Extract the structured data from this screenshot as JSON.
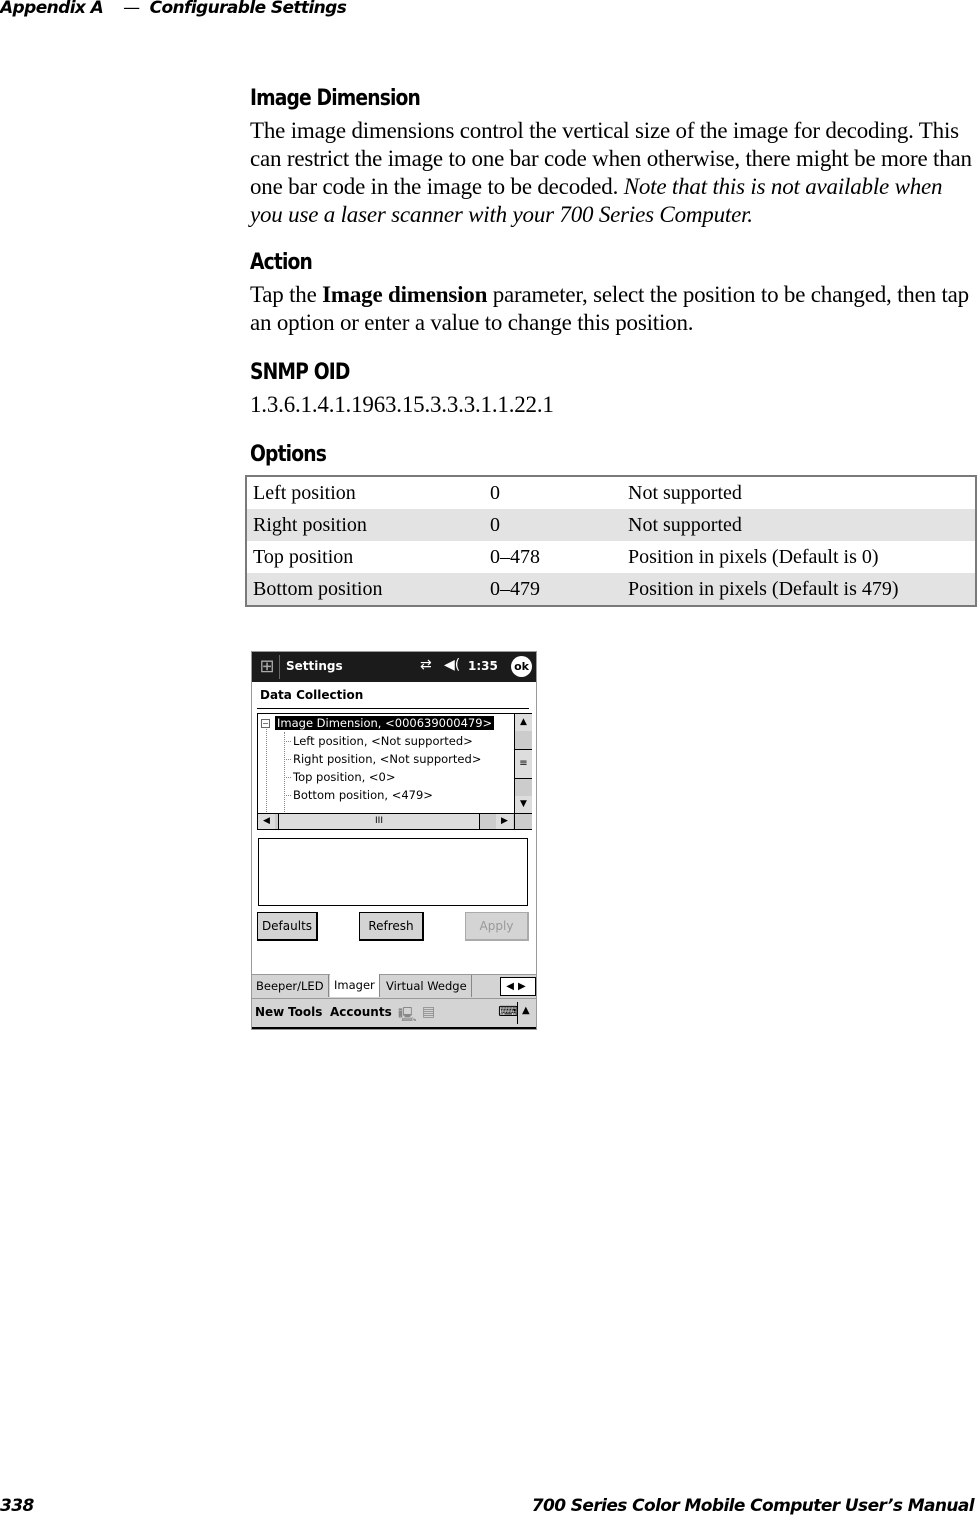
{
  "header": {
    "appendix": "Appendix A",
    "dash": "—",
    "chapter": "Configurable Settings"
  },
  "section": {
    "title": "Image Dimension",
    "body_plain": "The image dimensions control the vertical size of the image for decoding. This can restrict the image to one bar code when otherwise, there might be more than one bar code in the image to be decoded.",
    "body_note": "Note that this is not available when you use a laser scanner with your 700 Series Computer."
  },
  "action": {
    "title": "Action",
    "text_pre": "Tap the ",
    "text_bold": "Image dimension",
    "text_post": " parameter, select the position to be changed, then tap an option or enter a value to change this position."
  },
  "snmp": {
    "title": "SNMP OID",
    "value": "1.3.6.1.4.1.1963.15.3.3.3.1.1.22.1"
  },
  "options": {
    "title": "Options",
    "rows": [
      [
        "Left position",
        "0",
        "Not supported"
      ],
      [
        "Right position",
        "0",
        "Not supported"
      ],
      [
        "Top position",
        "0–478",
        "Position in pixels (Default is 0)"
      ],
      [
        "Bottom position",
        "0–479",
        "Position in pixels (Default is 479)"
      ]
    ]
  },
  "device": {
    "title": "Settings",
    "time": "1:35",
    "ok": "ok",
    "start_glyph": "⊞",
    "conn_glyph": "⇄",
    "vol_glyph": "◀(",
    "section": "Data Collection",
    "tree": {
      "root": "Image Dimension,  <000639000479>",
      "children": [
        "Left position,  <Not supported>",
        "Right position,  <Not supported>",
        "Top position,  <0>",
        "Bottom position,  <479>"
      ]
    },
    "scroll": {
      "up": "▲",
      "down": "▼",
      "left": "◀",
      "right": "▶",
      "thumb_v": "≡",
      "thumb_h": "III"
    },
    "buttons": {
      "defaults": "Defaults",
      "refresh": "Refresh",
      "apply": "Apply"
    },
    "tabs": [
      "Beeper/LED",
      "Imager",
      "Virtual Wedge"
    ],
    "active_tab": "Imager",
    "tab_arrows": "◀▶",
    "menu": [
      "New",
      "Tools",
      "Accounts"
    ],
    "menu_icons": [
      "🖳",
      "▤"
    ],
    "kb_glyph": "⌨",
    "up_glyph": "▲"
  },
  "footer": {
    "page": "338",
    "title": "700 Series Color Mobile Computer User’s Manual"
  }
}
